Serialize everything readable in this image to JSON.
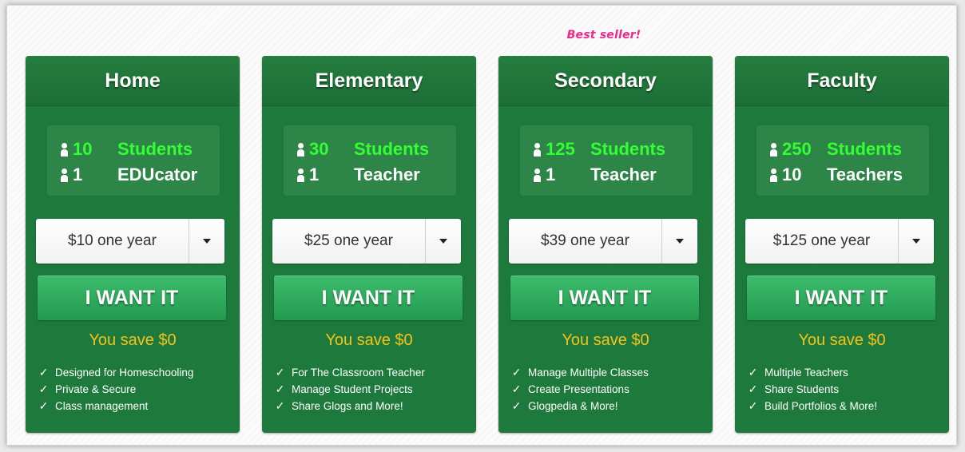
{
  "badge": "Best seller!",
  "cta_label": "I WANT IT",
  "icons": {
    "person": "person-icon",
    "check": "check-icon",
    "dropdown": "chevron-down-icon"
  },
  "colors": {
    "card_bg": "#1e7a3c",
    "button": "#2eab5c",
    "highlight_green": "#33ff33",
    "savings_yellow": "#f4c21a",
    "badge_pink": "#f0288c"
  },
  "plans": [
    {
      "title": "Home",
      "students_count": "10",
      "students_label": "Students",
      "staff_count": "1",
      "staff_label": "EDUcator",
      "price_option": "$10 one year",
      "savings": "You save $0",
      "features": [
        "Designed for Homeschooling",
        "Private & Secure",
        "Class management"
      ]
    },
    {
      "title": "Elementary",
      "students_count": "30",
      "students_label": "Students",
      "staff_count": "1",
      "staff_label": "Teacher",
      "price_option": "$25 one year",
      "savings": "You save $0",
      "features": [
        "For The Classroom Teacher",
        "Manage Student Projects",
        "Share Glogs and More!"
      ]
    },
    {
      "title": "Secondary",
      "students_count": "125",
      "students_label": "Students",
      "staff_count": "1",
      "staff_label": "Teacher",
      "price_option": "$39 one year",
      "savings": "You save $0",
      "features": [
        "Manage Multiple Classes",
        "Create Presentations",
        "Glogpedia & More!"
      ]
    },
    {
      "title": "Faculty",
      "students_count": "250",
      "students_label": "Students",
      "staff_count": "10",
      "staff_label": "Teachers",
      "price_option": "$125 one year",
      "savings": "You save $0",
      "features": [
        "Multiple Teachers",
        "Share Students",
        "Build Portfolios & More!"
      ]
    }
  ]
}
